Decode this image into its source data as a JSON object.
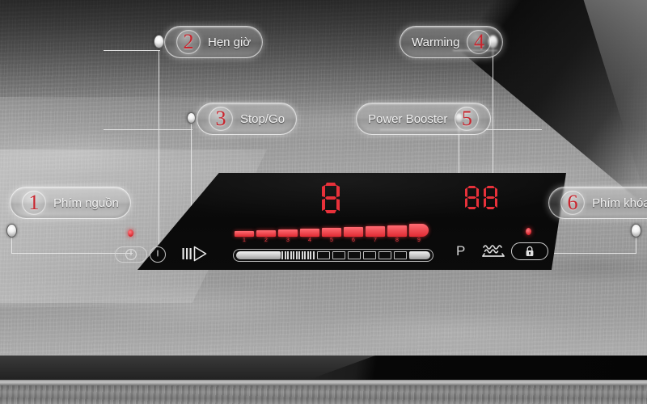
{
  "scene": {
    "title": "Induction hob control panel",
    "panel_bg": "#0b0b0b",
    "accent_red": "#e0282f",
    "callout_number_color": "#c8252e"
  },
  "callouts": [
    {
      "number": "1",
      "label": "Phím nguồn",
      "side": "left"
    },
    {
      "number": "2",
      "label": "Hẹn giờ",
      "side": "left"
    },
    {
      "number": "3",
      "label": "Stop/Go",
      "side": "left"
    },
    {
      "number": "4",
      "label": "Warming",
      "side": "right"
    },
    {
      "number": "5",
      "label": "Power Booster",
      "side": "right"
    },
    {
      "number": "6",
      "label": "Phím khóa",
      "side": "right"
    }
  ],
  "panel": {
    "timer_display": {
      "name": "timer-display",
      "digits": [
        "8",
        "8"
      ],
      "color": "#e0282f"
    },
    "zone_display": {
      "name": "zone-display",
      "digits": [
        "8"
      ],
      "color": "#e0282f"
    },
    "right_display": {
      "name": "right-display",
      "digits": [
        "8",
        "8"
      ],
      "color": "#e0282f"
    },
    "bargraph": {
      "name": "power-level-bargraph",
      "labels": [
        "1",
        "2",
        "3",
        "4",
        "5",
        "6",
        "7",
        "8",
        "9"
      ],
      "heights": [
        7,
        8,
        9,
        10,
        11,
        12,
        13,
        14,
        16
      ],
      "color": "#e0282f"
    },
    "slider": {
      "name": "power-slider",
      "value_label": "",
      "fill_percent": 22
    },
    "booster_letter": "P",
    "warming_icon": "warming-waves-icon",
    "lock_icon": "lock-icon",
    "power_icon": "power-icon",
    "timer_icon": "timer-clock-icon",
    "stopgo_icon": "stop-go-icon",
    "lock_indicator_on": true,
    "power_indicator_on": true
  }
}
